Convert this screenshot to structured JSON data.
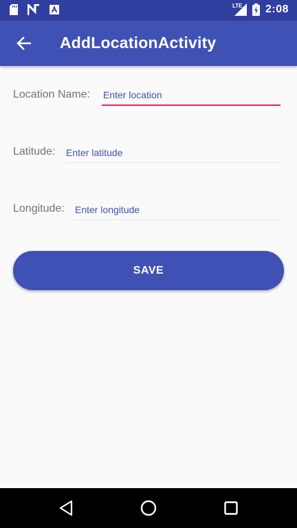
{
  "status_bar": {
    "time": "2:08",
    "network_label": "LTE",
    "icons": [
      "sd-card-icon",
      "n-notification-icon",
      "a-notification-icon",
      "lte-signal-icon",
      "battery-charging-icon"
    ]
  },
  "app_bar": {
    "title": "AddLocationActivity",
    "back_icon": "arrow-back-icon"
  },
  "form": {
    "location_name": {
      "label": "Location Name:",
      "value": "",
      "placeholder": "Enter location"
    },
    "latitude": {
      "label": "Latitude:",
      "value": "",
      "placeholder": "Enter latitude"
    },
    "longitude": {
      "label": "Longitude:",
      "value": "",
      "placeholder": "Enter longitude"
    }
  },
  "save_button": {
    "label": "SAVE"
  },
  "nav_bar": {
    "icons": [
      "back-triangle-icon",
      "home-circle-icon",
      "recents-square-icon"
    ]
  },
  "colors": {
    "primary": "#3f51b5",
    "primary_dark": "#303f9f",
    "accent": "#e91e63",
    "label_text": "#737373",
    "background": "#fafafa"
  }
}
